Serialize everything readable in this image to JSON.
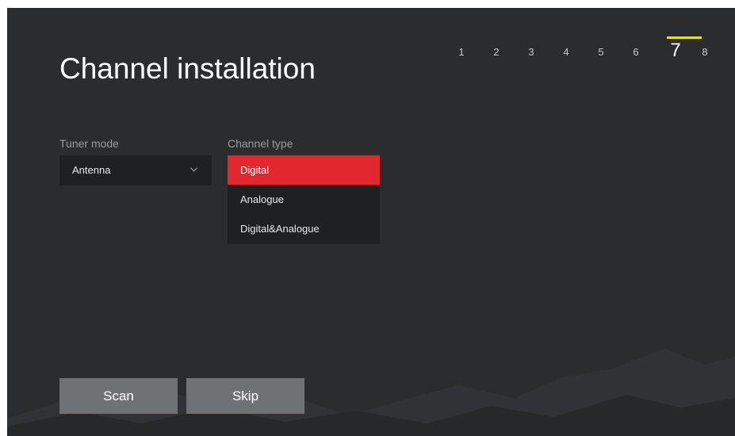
{
  "page": {
    "title": "Channel installation"
  },
  "stepper": {
    "steps": [
      "1",
      "2",
      "3",
      "4",
      "5",
      "6",
      "7",
      "8"
    ],
    "current_step": 7,
    "indicator_color": "#e6e22a"
  },
  "tuner_mode": {
    "label": "Tuner mode",
    "value": "Antenna",
    "icon": "chevron-down-icon"
  },
  "channel_type": {
    "label": "Channel type",
    "options": [
      "Digital",
      "Analogue",
      "Digital&Analogue"
    ],
    "selected_index": 0,
    "selected_color": "#e2272e"
  },
  "buttons": {
    "scan_label": "Scan",
    "skip_label": "Skip"
  },
  "colors": {
    "background": "#2b2c2e",
    "field_background": "#1f2022",
    "button_background": "#6f7275"
  }
}
